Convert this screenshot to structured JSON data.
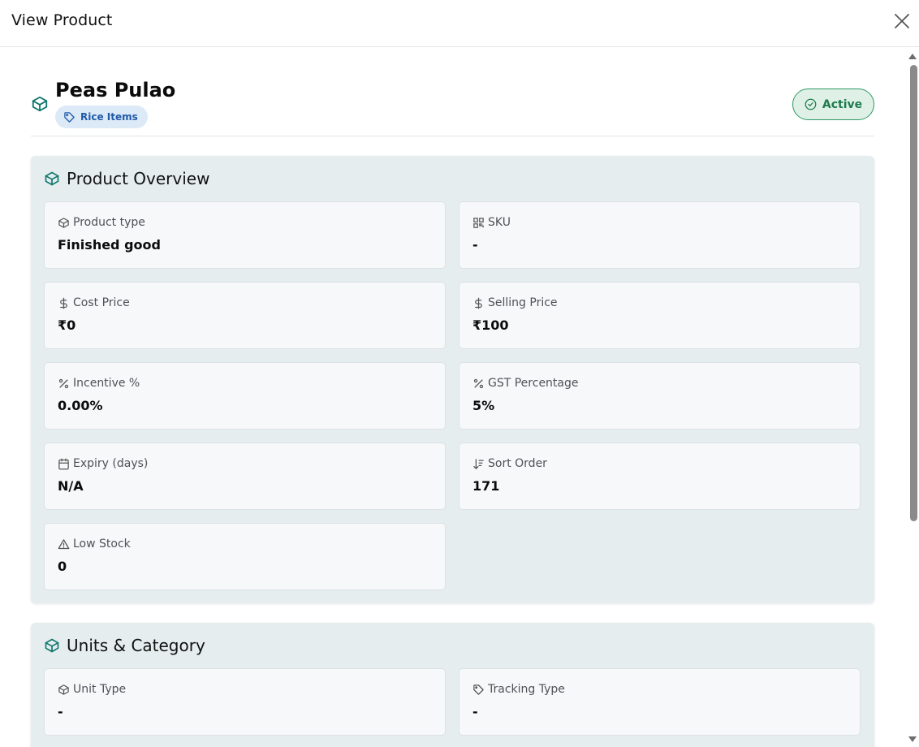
{
  "modal": {
    "title": "View Product",
    "close_icon": "close-icon"
  },
  "product": {
    "name": "Peas Pulao",
    "category": "Rice Items",
    "status": "Active"
  },
  "colors": {
    "accent_teal": "#0f766e",
    "badge_blue_bg": "#dce9f7",
    "badge_blue_text": "#1f5aa8",
    "status_green": "#1f7a4d",
    "status_green_bg": "#dff1e7",
    "section_bg": "#e5edee"
  },
  "overview": {
    "title": "Product Overview",
    "fields": [
      {
        "icon": "box-icon",
        "label": "Product type",
        "value": "Finished good"
      },
      {
        "icon": "qr-code-icon",
        "label": "SKU",
        "value": "-"
      },
      {
        "icon": "dollar-icon",
        "label": "Cost Price",
        "value": "₹0"
      },
      {
        "icon": "dollar-icon",
        "label": "Selling Price",
        "value": "₹100"
      },
      {
        "icon": "percent-icon",
        "label": "Incentive %",
        "value": "0.00%"
      },
      {
        "icon": "percent-icon",
        "label": "GST Percentage",
        "value": "5%"
      },
      {
        "icon": "calendar-icon",
        "label": "Expiry (days)",
        "value": "N/A"
      },
      {
        "icon": "sort-icon",
        "label": "Sort Order",
        "value": "171"
      },
      {
        "icon": "warning-icon",
        "label": "Low Stock",
        "value": "0"
      }
    ]
  },
  "units": {
    "title": "Units & Category",
    "fields": [
      {
        "icon": "box-icon",
        "label": "Unit Type",
        "value": "-"
      },
      {
        "icon": "tag-icon",
        "label": "Tracking Type",
        "value": "-"
      }
    ]
  }
}
